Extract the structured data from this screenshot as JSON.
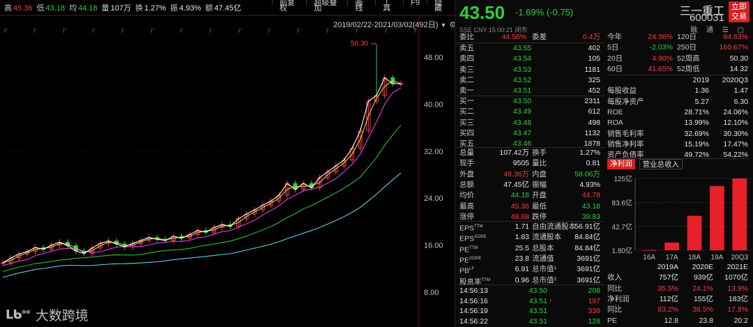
{
  "topbar": {
    "stats": [
      {
        "label": "高",
        "value": "45.36",
        "color": "red"
      },
      {
        "label": "低",
        "value": "43.18",
        "color": "green"
      },
      {
        "label": "均",
        "value": "44.18",
        "color": "green"
      },
      {
        "label": "量",
        "value": "107万",
        "color": "white"
      },
      {
        "label": "换",
        "value": "1.27%",
        "color": "white"
      },
      {
        "label": "振",
        "value": "4.93%",
        "color": "white"
      },
      {
        "label": "额",
        "value": "47.45亿",
        "color": "white"
      }
    ],
    "menu": [
      "前复权",
      "超级叠加",
      "画线",
      "工具",
      "F9",
      "隐藏"
    ]
  },
  "chart": {
    "date_range": "2019/02/22-2021/03/02(492日)",
    "y_ticks": [
      "48.00",
      "40.00",
      "32.00",
      "24.00",
      "16.00",
      "8.00"
    ],
    "peak_label": "50.30"
  },
  "chart_data": {
    "type": "candlestick-line",
    "date_range": "2019/02/22-2021/03/02(492日)",
    "yticks": [
      48,
      40,
      32,
      24,
      16,
      8
    ],
    "ylim": [
      5.5,
      53
    ],
    "peak": 50.3,
    "close": [
      13.0,
      13.8,
      14.5,
      14.9,
      15.6,
      15.3,
      16.0,
      16.5,
      15.9,
      15.0,
      14.6,
      15.5,
      16.3,
      16.7,
      16.2,
      15.7,
      16.3,
      16.8,
      17.3,
      17.0,
      16.8,
      17.5,
      17.2,
      17.8,
      18.5,
      18.2,
      19.0,
      19.5,
      19.2,
      20.5,
      21.3,
      22.0,
      22.8,
      23.5,
      24.5,
      26.5,
      25.5,
      26.5,
      25.8,
      27.5,
      28.5,
      29.5,
      30.5,
      32.5,
      35.5,
      40.5,
      41.5,
      44.5,
      43.5,
      43.5
    ]
  },
  "footer": {
    "logo_mark": "ᒪᑲᐤᐤ",
    "logo_text": "大数跨境"
  },
  "quote": {
    "price": "43.50",
    "change": "-1.69%",
    "change_abs": "(-0.75)",
    "name": "三一重工",
    "code": "600031",
    "trade_btn": [
      "立即",
      "交易"
    ],
    "subinfo": "SSE  CNY  15:00:21  闭市",
    "subicons": "融 通 ☰ ▢"
  },
  "order_head": {
    "wb_label": "委比",
    "wb_value": "44.58%",
    "wc_label": "委差",
    "wc_value": "0.4万"
  },
  "sells": [
    {
      "label": "卖五",
      "price": "43.55",
      "vol": "402"
    },
    {
      "label": "卖四",
      "price": "43.54",
      "vol": "105"
    },
    {
      "label": "卖三",
      "price": "43.53",
      "vol": "1181"
    },
    {
      "label": "卖二",
      "price": "43.52",
      "vol": "325"
    },
    {
      "label": "卖一",
      "price": "43.51",
      "vol": "452"
    }
  ],
  "buys": [
    {
      "label": "买一",
      "price": "43.50",
      "vol": "2311"
    },
    {
      "label": "买二",
      "price": "43.49",
      "vol": "612"
    },
    {
      "label": "买三",
      "price": "43.48",
      "vol": "498"
    },
    {
      "label": "买四",
      "price": "43.47",
      "vol": "1132"
    },
    {
      "label": "买五",
      "price": "43.46",
      "vol": "1878"
    }
  ],
  "stats": [
    {
      "l1": "总量",
      "v1": "107.42万",
      "c1": "white",
      "l2": "换手",
      "v2": "1.27%",
      "c2": "white"
    },
    {
      "l1": "现手",
      "v1": "9505",
      "c1": "white",
      "l2": "量比",
      "v2": "0.81",
      "c2": "white"
    },
    {
      "l1": "外盘",
      "v1": "49.36万",
      "c1": "red",
      "l2": "内盘",
      "v2": "58.06万",
      "c2": "green"
    },
    {
      "l1": "总额",
      "v1": "47.45亿",
      "c1": "white",
      "l2": "振幅",
      "v2": "4.93%",
      "c2": "white"
    },
    {
      "l1": "均价",
      "v1": "44.18",
      "c1": "green",
      "l2": "开盘",
      "v2": "44.78",
      "c2": "red"
    },
    {
      "l1": "最高",
      "v1": "45.36",
      "c1": "red",
      "l2": "最低",
      "v2": "43.18",
      "c2": "green"
    },
    {
      "l1": "涨停",
      "v1": "48.68",
      "c1": "red",
      "l2": "跌停",
      "v2": "39.83",
      "c2": "green"
    }
  ],
  "shares": [
    {
      "l1": "EPS",
      "s1": "TTM",
      "v1": "1.71",
      "l2": "自由流通股本",
      "v2": "56.91亿"
    },
    {
      "l1": "EPS",
      "s1": "2020E",
      "v1": "1.83",
      "l2": "流通股本",
      "v2": "84.84亿"
    },
    {
      "l1": "PE",
      "s1": "TTM",
      "v1": "25.5",
      "l2": "总股本",
      "v2": "84.84亿"
    },
    {
      "l1": "PE",
      "s1": "2020E",
      "v1": "23.8",
      "l2": "流通值",
      "v2": "3691亿"
    },
    {
      "l1": "PB",
      "s1": "LF",
      "v1": "6.91",
      "l2": "总市值¹",
      "v2": "3691亿"
    },
    {
      "l1": "股息率",
      "s1": "TTM",
      "v1": "0.96",
      "l2": "总市值²",
      "v2": "3691亿"
    }
  ],
  "ticks": [
    {
      "time": "14:56:13",
      "price": "43.50",
      "arrow": "",
      "vol": "208",
      "vcolor": "green"
    },
    {
      "time": "14:56:16",
      "price": "43.51",
      "arrow": "↑",
      "vol": "197",
      "vcolor": "red"
    },
    {
      "time": "14:56:19",
      "price": "43.51",
      "arrow": "",
      "vol": "338",
      "vcolor": "red"
    },
    {
      "time": "14:56:22",
      "price": "43.51",
      "arrow": "",
      "vol": "128",
      "vcolor": "green"
    }
  ],
  "perf": [
    {
      "l1": "今年",
      "v1": "24.36%",
      "c1": "red",
      "l2": "120日",
      "v2": "94.63%",
      "c2": "red"
    },
    {
      "l1": "5日",
      "v1": "-2.03%",
      "c1": "green",
      "l2": "250日",
      "v2": "160.67%",
      "c2": "red"
    },
    {
      "l1": "20日",
      "v1": "4.90%",
      "c1": "red",
      "l2": "52周高",
      "v2": "50.30",
      "c2": "white"
    },
    {
      "l1": "60日",
      "v1": "41.65%",
      "c1": "red",
      "l2": "52周低",
      "v2": "14.32",
      "c2": "white"
    }
  ],
  "fin_head": [
    "2019",
    "2020Q3"
  ],
  "fin": [
    {
      "l": "每股收益",
      "a": "1.36",
      "b": "1.47"
    },
    {
      "l": "每股净资产",
      "a": "5.27",
      "b": "6.30"
    },
    {
      "l": "ROE",
      "a": "28.71%",
      "b": "24.06%"
    },
    {
      "l": "ROA",
      "a": "13.99%",
      "b": "12.10%"
    },
    {
      "l": "销售毛利率",
      "a": "32.69%",
      "b": "30.30%"
    },
    {
      "l": "销售净利率",
      "a": "15.19%",
      "b": "17.47%"
    },
    {
      "l": "资产负债率",
      "a": "49.72%",
      "b": "54.22%"
    }
  ],
  "mini_tabs": {
    "active": "净利润",
    "other": "营业总收入"
  },
  "mini_chart": {
    "type": "bar",
    "categories": [
      "16A",
      "17A",
      "18A",
      "19A",
      "20Q3"
    ],
    "values": [
      2.0,
      15.0,
      61.0,
      112.0,
      125.0
    ],
    "y_ticks": [
      "125亿",
      "83.6亿",
      "42.7亿",
      "1.80亿"
    ],
    "ylim": [
      1.8,
      125
    ]
  },
  "forecast": {
    "head": [
      "2019A",
      "2020E",
      "2021E"
    ],
    "rows": [
      {
        "l": "收入",
        "a": "757亿",
        "b": "939亿",
        "c": "1070亿",
        "colored": false
      },
      {
        "l": "同比",
        "a": "35.5%",
        "b": "24.1%",
        "c": "13.9%",
        "colored": true
      },
      {
        "l": "净利润",
        "a": "112亿",
        "b": "155亿",
        "c": "183亿",
        "colored": false
      },
      {
        "l": "同比",
        "a": "83.2%",
        "b": "38.5%",
        "c": "17.8%",
        "colored": true
      },
      {
        "l": "PE",
        "a": "12.8",
        "b": "23.8",
        "c": "20.2",
        "colored": false
      }
    ]
  },
  "colors": {
    "red": "#ff3b3b",
    "green": "#28d23c",
    "accent": "#d62020",
    "ma5": "#ffffff",
    "ma10": "#e8c84a",
    "ma20": "#e040e0",
    "ma60": "#2fbf2f",
    "ma120": "#5fd0e8"
  }
}
